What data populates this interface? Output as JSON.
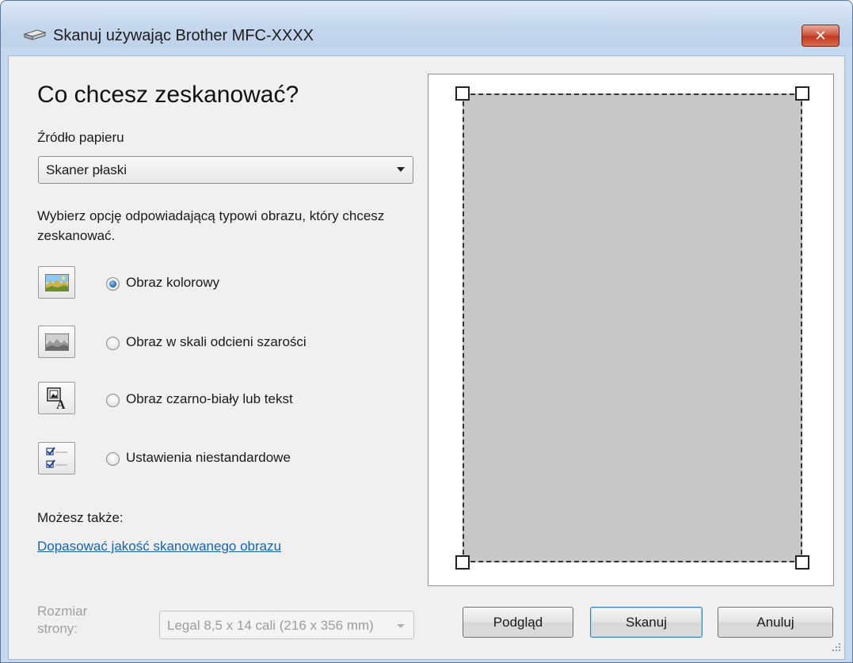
{
  "window": {
    "title": "Skanuj używając Brother MFC-XXXX",
    "close_label": "✕"
  },
  "main": {
    "heading": "Co chcesz zeskanować?",
    "paper_source_label": "Źródło papieru",
    "paper_source_value": "Skaner płaski",
    "description": "Wybierz opcję odpowiadającą typowi obrazu, który chcesz zeskanować.",
    "options": [
      {
        "label": "Obraz kolorowy",
        "icon": "color-picture-icon",
        "selected": true
      },
      {
        "label": "Obraz w skali odcieni szarości",
        "icon": "grayscale-picture-icon",
        "selected": false
      },
      {
        "label": "Obraz czarno-biały lub tekst",
        "icon": "black-white-text-icon",
        "selected": false
      },
      {
        "label": "Ustawienia niestandardowe",
        "icon": "custom-settings-icon",
        "selected": false
      }
    ],
    "also_label": "Możesz także:",
    "adjust_link": "Dopasować jakość skanowanego obrazu",
    "page_size_label_line1": "Rozmiar",
    "page_size_label_line2": "strony:",
    "page_size_value": "Legal 8,5 x 14 cali (216 x 356 mm)"
  },
  "buttons": {
    "preview": "Podgląd",
    "scan": "Skanuj",
    "cancel": "Anuluj"
  }
}
